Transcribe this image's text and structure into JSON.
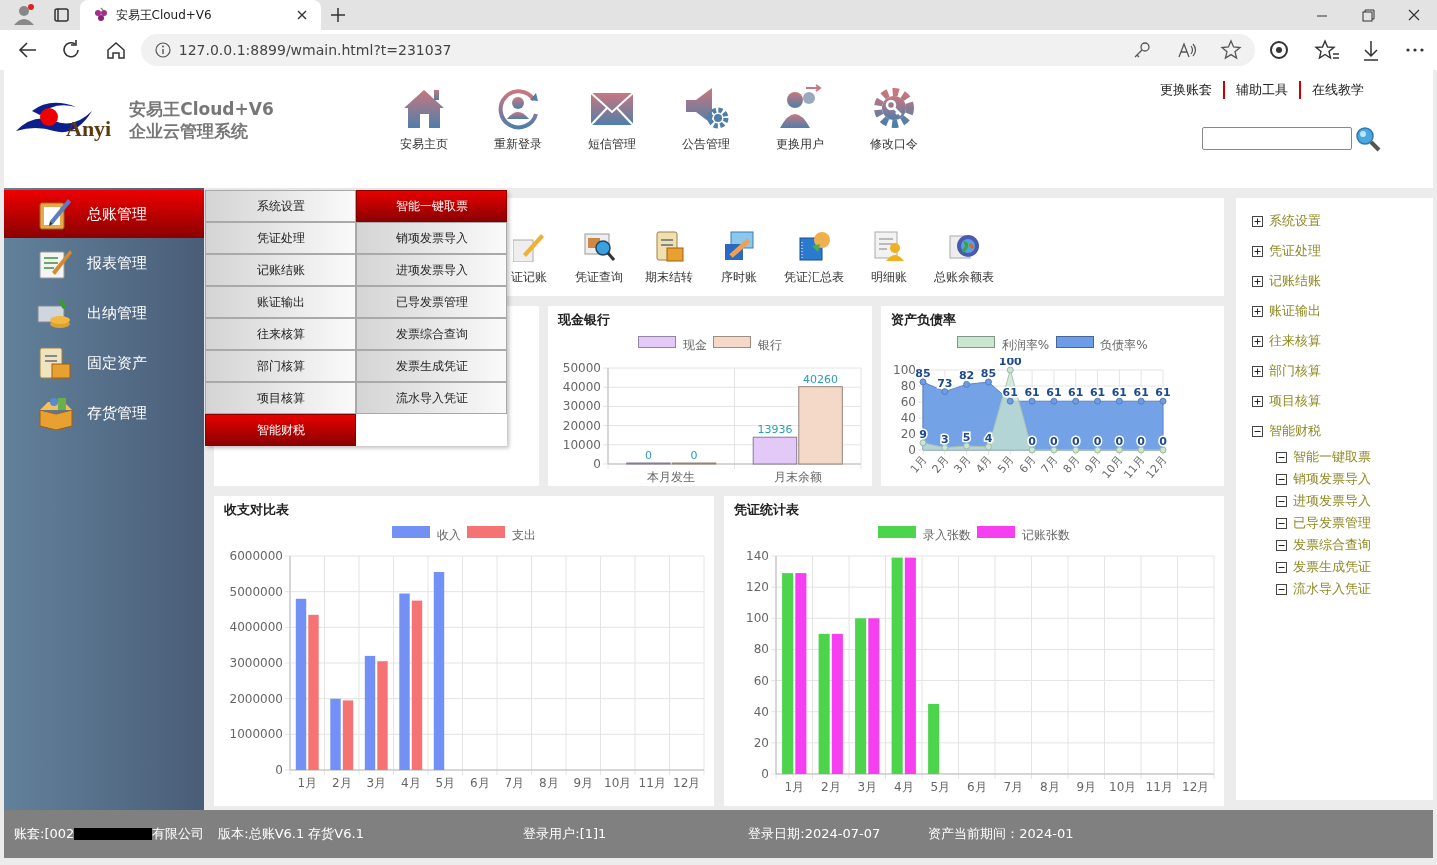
{
  "browser": {
    "tab_title": "安易王Cloud+V6",
    "url": "127.0.0.1:8899/wmain.html?t=231037"
  },
  "app": {
    "logo_text": "Anyi",
    "title": "安易王Cloud+V6",
    "subtitle": "企业云管理系统"
  },
  "nav": [
    "安易主页",
    "重新登录",
    "短信管理",
    "公告管理",
    "更换用户",
    "修改口令"
  ],
  "top_links": [
    "更换账套",
    "辅助工具",
    "在线教学"
  ],
  "sidebar": [
    {
      "label": "总账管理",
      "selected": true
    },
    {
      "label": "报表管理",
      "selected": false
    },
    {
      "label": "出纳管理",
      "selected": false
    },
    {
      "label": "固定资产",
      "selected": false
    },
    {
      "label": "存货管理",
      "selected": false
    }
  ],
  "menu": {
    "columns": [
      [
        {
          "label": "系统设置",
          "selected": false
        },
        {
          "label": "凭证处理",
          "selected": false
        },
        {
          "label": "记账结账",
          "selected": false
        },
        {
          "label": "账证输出",
          "selected": false
        },
        {
          "label": "往来核算",
          "selected": false
        },
        {
          "label": "部门核算",
          "selected": false
        },
        {
          "label": "项目核算",
          "selected": false
        },
        {
          "label": "智能财税",
          "selected": true
        }
      ],
      [
        {
          "label": "智能一键取票",
          "selected": true
        },
        {
          "label": "销项发票导入",
          "selected": false
        },
        {
          "label": "进项发票导入",
          "selected": false
        },
        {
          "label": "已导发票管理",
          "selected": false
        },
        {
          "label": "发票综合查询",
          "selected": false
        },
        {
          "label": "发票生成凭证",
          "selected": false
        },
        {
          "label": "流水导入凭证",
          "selected": false
        }
      ]
    ]
  },
  "toolbar": [
    "证记账",
    "凭证查询",
    "期末结转",
    "序时账",
    "凭证汇总表",
    "明细账",
    "总账余额表"
  ],
  "panels": [
    {
      "chart_data": {
        "type": "bar",
        "title": "现金银行",
        "categories": [
          "本月发生",
          "月末余额"
        ],
        "series": [
          {
            "name": "现金",
            "color": "#e3c9f7",
            "values": [
              0,
              13936
            ]
          },
          {
            "name": "银行",
            "color": "#f5d9c8",
            "values": [
              0,
              40260
            ]
          }
        ],
        "ylim": [
          0,
          50000
        ],
        "yticks": [
          0,
          10000,
          20000,
          30000,
          40000,
          50000
        ],
        "grid": true,
        "data_labels": true
      }
    },
    {
      "chart_data": {
        "type": "area",
        "title": "资产负债率",
        "categories": [
          "1月",
          "2月",
          "3月",
          "4月",
          "5月",
          "6月",
          "7月",
          "8月",
          "9月",
          "10月",
          "11月",
          "12月"
        ],
        "series": [
          {
            "name": "利润率%",
            "color": "#c8e6d0",
            "values": [
              9,
              3,
              5,
              4,
              100,
              0,
              0,
              0,
              0,
              0,
              0,
              0
            ]
          },
          {
            "name": "负债率%",
            "color": "#6d9de6",
            "values": [
              85,
              73,
              82,
              85,
              61,
              61,
              61,
              61,
              61,
              61,
              61,
              61
            ]
          }
        ],
        "ylim": [
          0,
          100
        ],
        "yticks": [
          0,
          20,
          40,
          60,
          80,
          100
        ],
        "grid": true,
        "data_labels": true
      }
    },
    {
      "chart_data": {
        "type": "bar",
        "title": "收支对比表",
        "categories": [
          "1月",
          "2月",
          "3月",
          "4月",
          "5月",
          "6月",
          "7月",
          "8月",
          "9月",
          "10月",
          "11月",
          "12月"
        ],
        "series": [
          {
            "name": "收入",
            "color": "#7391f5",
            "values": [
              4800000,
              2000000,
              3200000,
              4950000,
              5550000,
              null,
              null,
              null,
              null,
              null,
              null,
              null
            ]
          },
          {
            "name": "支出",
            "color": "#f57373",
            "values": [
              4350000,
              1950000,
              3050000,
              4750000,
              null,
              null,
              null,
              null,
              null,
              null,
              null,
              null
            ]
          }
        ],
        "ylim": [
          0,
          6000000
        ],
        "yticks": [
          0,
          1000000,
          2000000,
          3000000,
          4000000,
          5000000,
          6000000
        ],
        "grid": true
      }
    },
    {
      "chart_data": {
        "type": "bar",
        "title": "凭证统计表",
        "categories": [
          "1月",
          "2月",
          "3月",
          "4月",
          "5月",
          "6月",
          "7月",
          "8月",
          "9月",
          "10月",
          "11月",
          "12月"
        ],
        "series": [
          {
            "name": "录入张数",
            "color": "#4cd44c",
            "values": [
              129,
              90,
              100,
              139,
              45,
              null,
              null,
              null,
              null,
              null,
              null,
              null
            ]
          },
          {
            "name": "记账张数",
            "color": "#f53ff0",
            "values": [
              129,
              90,
              100,
              139,
              null,
              null,
              null,
              null,
              null,
              null,
              null,
              null
            ]
          }
        ],
        "ylim": [
          0,
          140
        ],
        "yticks": [
          0,
          20,
          40,
          60,
          80,
          100,
          120,
          140
        ],
        "grid": true
      }
    }
  ],
  "tree": [
    {
      "label": "系统设置",
      "expanded": false
    },
    {
      "label": "凭证处理",
      "expanded": false
    },
    {
      "label": "记账结账",
      "expanded": false
    },
    {
      "label": "账证输出",
      "expanded": false
    },
    {
      "label": "往来核算",
      "expanded": false
    },
    {
      "label": "部门核算",
      "expanded": false
    },
    {
      "label": "项目核算",
      "expanded": false
    },
    {
      "label": "智能财税",
      "expanded": true,
      "children": [
        {
          "label": "智能一键取票",
          "expanded": true
        },
        {
          "label": "销项发票导入",
          "expanded": true
        },
        {
          "label": "进项发票导入",
          "expanded": true
        },
        {
          "label": "已导发票管理",
          "expanded": true
        },
        {
          "label": "发票综合查询",
          "expanded": true
        },
        {
          "label": "发票生成凭证",
          "expanded": true
        },
        {
          "label": "流水导入凭证",
          "expanded": true
        }
      ]
    }
  ],
  "status_bar": {
    "account_prefix": "账套:[002",
    "account_suffix": "有限公司",
    "version": "版本:总账V6.1 存货V6.1",
    "user": "登录用户:[1]1",
    "login_date": "登录日期:2024-07-07",
    "period": "资产当前期间：2024-01"
  }
}
